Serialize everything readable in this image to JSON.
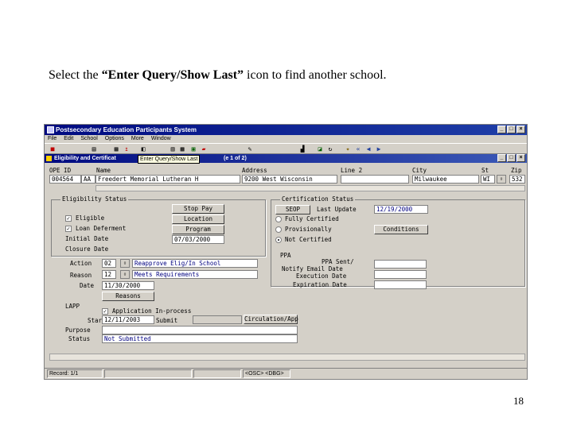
{
  "slide": {
    "caption_pre": "Select the ",
    "caption_bold": "“Enter Query/Show Last”",
    "caption_post": " icon to find another school.",
    "page_number": "18"
  },
  "window": {
    "title": "Postsecondary Education Participants System",
    "menu": [
      "File",
      "Edit",
      "School",
      "Options",
      "More",
      "Window"
    ],
    "tooltip": "Enter Query/Show Last",
    "subwindow_title": "Eligibility and Certificat",
    "subwindow_title_suffix": "(e 1 of 2)"
  },
  "header": {
    "opeid_label": "OPE ID",
    "name_label": "Name",
    "address_label": "Address",
    "line2_label": "Line 2",
    "city_label": "City",
    "state_label": "St",
    "zip_label": "Zip",
    "opeid": "004564",
    "opeid_suffix": "AA",
    "name": "Freedert Memorial Lutheran H",
    "address": "9200 West Wisconsin",
    "line2": "",
    "city": "Milwaukee",
    "state": "WI",
    "zip": "532"
  },
  "eligibility": {
    "group_title": "Eligibility Status",
    "eligible_label": "Eligible",
    "eligible_checked": true,
    "loan_deferment_label": "Loan Deferment",
    "loan_deferment_checked": true,
    "initial_date_label": "Initial Date",
    "closure_date_label": "Closure Date",
    "initial_date": "",
    "closure_date": "",
    "stop_pay_button": "Stop Pay",
    "location_button": "Location",
    "program_button": "Program",
    "program_date": "07/03/2000",
    "action_label": "Action",
    "action_code": "02",
    "action_text": "Reapprove Elig/In School",
    "reason_label": "Reason",
    "reason_code": "12",
    "reason_text": "Meets Requirements",
    "date_label": "Date",
    "date_value": "11/30/2000",
    "reasons_button": "Reasons"
  },
  "certification": {
    "group_title": "Certification Status",
    "seop_button": "SEOP",
    "last_update_label": "Last Update",
    "last_update": "12/19/2000",
    "fully_certified_label": "Fully Certified",
    "provisionally_label": "Provisionally",
    "not_certified_label": "Not Certified",
    "selected": "not_certified",
    "conditions_button": "Conditions",
    "ppa_label": "PPA",
    "ppa_sent_label": "PPA Sent/",
    "notify_email_label": "Notify Email Date",
    "execution_date_label": "Execution Date",
    "expiration_date_label": "Expiration Date",
    "ppa_sent": "",
    "execution_date": "",
    "expiration_date": ""
  },
  "lapp": {
    "lapp_label": "LAPP",
    "application_label": "Application In-process",
    "application_checked": true,
    "start_label": "Start",
    "start_date": "12/11/2003",
    "submit_label": "Submit",
    "submit_value": "",
    "circulation_button": "Circulation/App",
    "purpose_label": "Purpose",
    "purpose_value": "",
    "status_label": "Status",
    "status_value": "Not Submitted"
  },
  "statusbar": {
    "record": "Record: 1/1",
    "cell2": "",
    "cell3": "",
    "cell4": "<OSC> <DBG>"
  }
}
